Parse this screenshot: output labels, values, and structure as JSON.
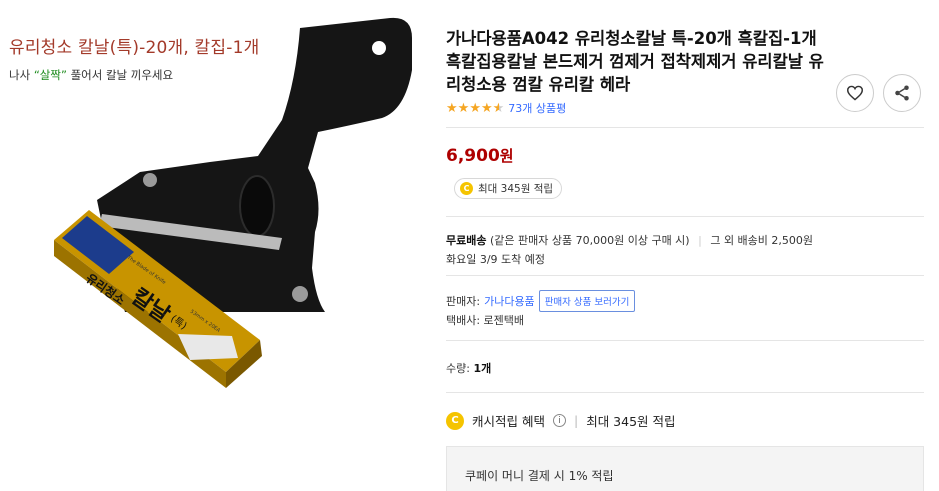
{
  "image": {
    "title": "유리청소 칼날(특)-20개, 칼집-1개",
    "sub_prefix": "나사",
    "sub_highlight": "“살짝”",
    "sub_suffix": "풀어서 칼날 끼우세요",
    "box_brand": "유리청소",
    "box_product": "칼날",
    "box_tag": "(특)",
    "box_en": "The Blade of Knife",
    "box_size": "53mm x 20EA"
  },
  "product": {
    "title": "가나다용품A042 유리청소칼날 특-20개 흑칼집-1개 흑칼집용칼날 본드제거 껌제거 접착제제거 유리칼날 유리청소용 껌칼 유리칼 헤라",
    "rating": 4.5,
    "review_count": "73개 상품평",
    "price": "6,900",
    "price_unit": "원",
    "cash_pill": "최대 345원 적립"
  },
  "shipping": {
    "free_label": "무료배송",
    "condition": "(같은 판매자 상품 70,000원 이상 구매 시)",
    "other": "그 외 배송비 2,500원",
    "arrival": "화요일 3/9 도착 예정"
  },
  "seller": {
    "label": "판매자:",
    "name": "가나다용품",
    "button": "판매자 상품 보러가기",
    "courier": "택배사: 로젠택배"
  },
  "quantity": {
    "label": "수량:",
    "value": "1개"
  },
  "cash": {
    "label": "캐시적립 혜택",
    "info_icon": "i",
    "max": "최대 345원 적립"
  },
  "coupay": {
    "text": "쿠페이 머니 결제 시 1% 적립"
  },
  "colors": {
    "price": "#ae0000",
    "link": "#346aff",
    "star": "#f5a623",
    "coin": "#f5c400"
  }
}
